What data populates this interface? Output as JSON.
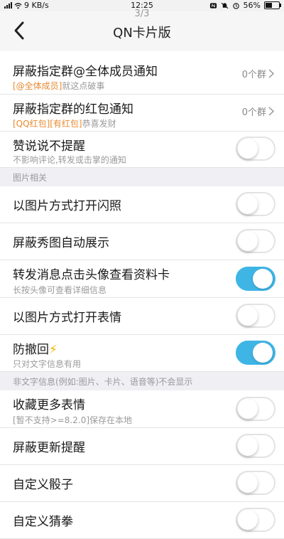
{
  "status_bar": {
    "network_speed": "9 KB/s",
    "time": "12:25",
    "battery_percent": "56%",
    "battery_level": 0.56
  },
  "nav": {
    "title": "QN卡片版",
    "page_indicator": "3/3",
    "back_icon": "chevron-left-icon"
  },
  "rows": {
    "mention_all": {
      "title": "屏蔽指定群@全体成员通知",
      "sub_tag": "[@全体成员]",
      "sub_text": "就这点破事",
      "value": "0个群"
    },
    "red_packet": {
      "title": "屏蔽指定群的红包通知",
      "sub_tag": "[QQ红包][有红包]",
      "sub_text": "恭喜发财",
      "value": "0个群"
    },
    "like_status": {
      "title": "赞说说不提醒",
      "sub": "不影响评论,转发或击掌的通知",
      "on": false
    },
    "section_images": "图片相关",
    "flash_image": {
      "title": "以图片方式打开闪照",
      "on": false
    },
    "show_pic": {
      "title": "屏蔽秀图自动展示",
      "on": false
    },
    "forward_avatar": {
      "title": "转发消息点击头像查看资料卡",
      "sub": "长按头像可查看详细信息",
      "on": true
    },
    "emoticon_image": {
      "title": "以图片方式打开表情",
      "on": false
    },
    "anti_recall": {
      "title": "防撤回",
      "emoji": "⚡",
      "sub": "只对文字信息有用",
      "on": true
    },
    "section_non_text": "非文字信息(例如:图片、卡片、语音等)不会显示",
    "more_emoticons": {
      "title": "收藏更多表情",
      "sub": "[暂不支持>=8.2.0]保存在本地",
      "on": false
    },
    "update_notice": {
      "title": "屏蔽更新提醒",
      "on": false
    },
    "custom_dice": {
      "title": "自定义骰子",
      "on": false
    },
    "custom_rps": {
      "title": "自定义猜拳",
      "on": false
    }
  },
  "colors": {
    "switch_on": "#3fb5e6",
    "tag_orange": "#e98a2f",
    "background": "#efeff4"
  }
}
